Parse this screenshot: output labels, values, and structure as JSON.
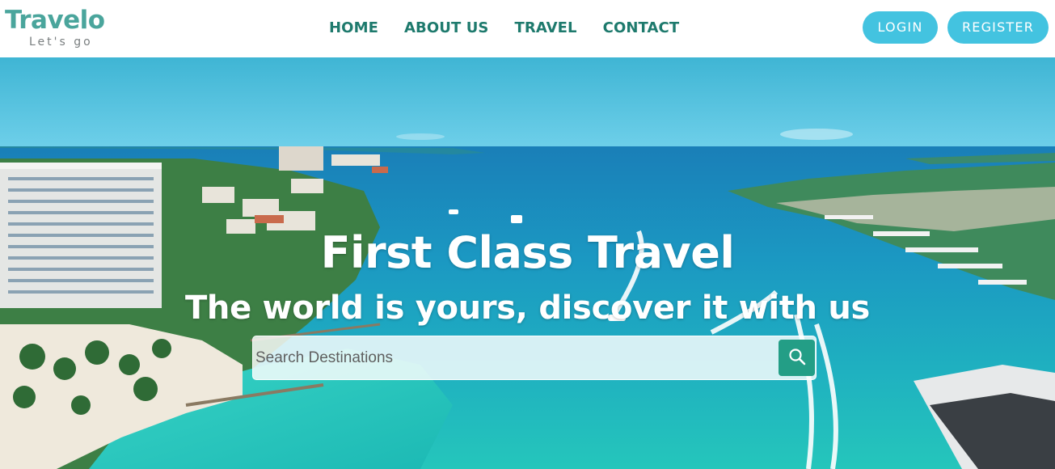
{
  "logo": {
    "name": "Travelo",
    "tagline": "Let's go"
  },
  "nav": {
    "items": [
      {
        "label": "HOME"
      },
      {
        "label": "ABOUT US"
      },
      {
        "label": "TRAVEL"
      },
      {
        "label": "CONTACT"
      }
    ]
  },
  "auth": {
    "login_label": "LOGIN",
    "register_label": "REGISTER"
  },
  "hero": {
    "title": "First Class Travel",
    "subtitle": "The world is yours, discover it with us"
  },
  "search": {
    "placeholder": "Search Destinations",
    "value": "",
    "button_icon": "search-icon"
  },
  "colors": {
    "logo": "#4aa59c",
    "nav_text": "#1e7a6d",
    "auth_button": "#43c3e0",
    "search_button": "#239e86",
    "header_bg": "#ffffff"
  }
}
